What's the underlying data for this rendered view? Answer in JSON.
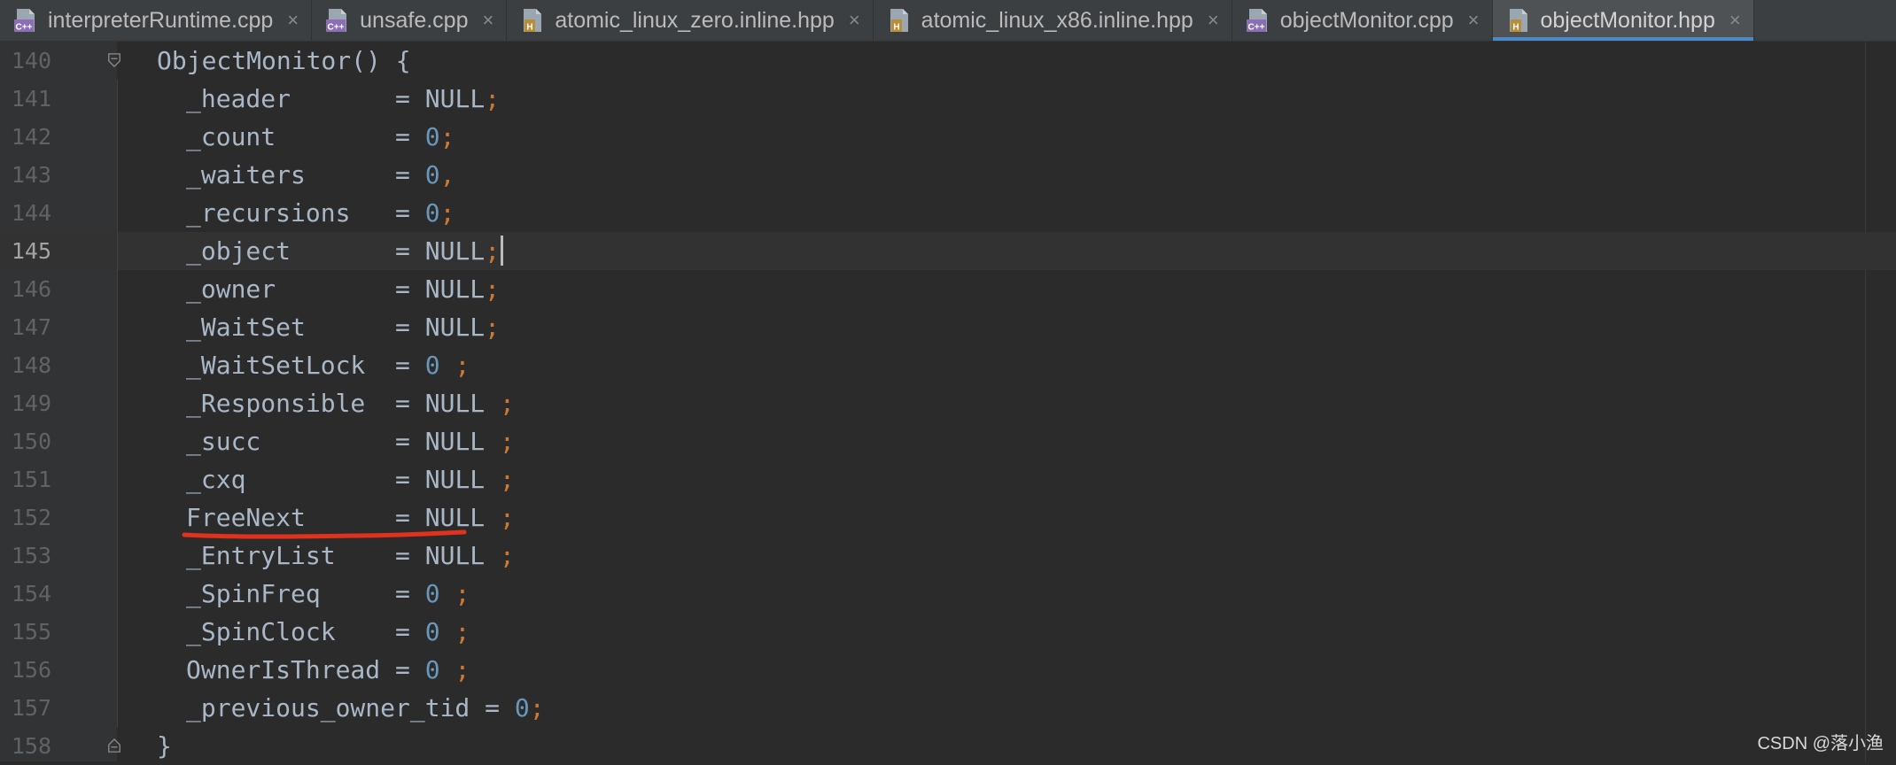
{
  "tabs": [
    {
      "label": "interpreterRuntime.cpp",
      "type": "cpp",
      "active": false
    },
    {
      "label": "unsafe.cpp",
      "type": "cpp",
      "active": false
    },
    {
      "label": "atomic_linux_zero.inline.hpp",
      "type": "hpp",
      "active": false
    },
    {
      "label": "atomic_linux_x86.inline.hpp",
      "type": "hpp",
      "active": false
    },
    {
      "label": "objectMonitor.cpp",
      "type": "cpp",
      "active": false
    },
    {
      "label": "objectMonitor.hpp",
      "type": "hpp",
      "active": true
    }
  ],
  "tab_close_glyph": "×",
  "icon_text": {
    "cpp": "C++",
    "hpp": "H"
  },
  "code": {
    "current_line": 145,
    "lines": [
      {
        "number": "140",
        "text": "ObjectMonitor() {"
      },
      {
        "number": "141",
        "name": "_header",
        "pad": "       ",
        "eq": "= ",
        "value": "NULL",
        "value_kind": "ident",
        "sep": "",
        "semi": ";"
      },
      {
        "number": "142",
        "name": "_count",
        "pad": "        ",
        "eq": "= ",
        "value": "0",
        "value_kind": "num",
        "sep": "",
        "semi": ";"
      },
      {
        "number": "143",
        "name": "_waiters",
        "pad": "      ",
        "eq": "= ",
        "value": "0",
        "value_kind": "num",
        "sep": "",
        "semi": ","
      },
      {
        "number": "144",
        "name": "_recursions",
        "pad": "   ",
        "eq": "= ",
        "value": "0",
        "value_kind": "num",
        "sep": "",
        "semi": ";"
      },
      {
        "number": "145",
        "name": "_object",
        "pad": "       ",
        "eq": "= ",
        "value": "NULL",
        "value_kind": "ident",
        "sep": "",
        "semi": ";"
      },
      {
        "number": "146",
        "name": "_owner",
        "pad": "        ",
        "eq": "= ",
        "value": "NULL",
        "value_kind": "ident",
        "sep": "",
        "semi": ";"
      },
      {
        "number": "147",
        "name": "_WaitSet",
        "pad": "      ",
        "eq": "= ",
        "value": "NULL",
        "value_kind": "ident",
        "sep": "",
        "semi": ";"
      },
      {
        "number": "148",
        "name": "_WaitSetLock",
        "pad": "  ",
        "eq": "= ",
        "value": "0",
        "value_kind": "num",
        "sep": " ",
        "semi": ";"
      },
      {
        "number": "149",
        "name": "_Responsible",
        "pad": "  ",
        "eq": "= ",
        "value": "NULL",
        "value_kind": "ident",
        "sep": " ",
        "semi": ";"
      },
      {
        "number": "150",
        "name": "_succ",
        "pad": "         ",
        "eq": "= ",
        "value": "NULL",
        "value_kind": "ident",
        "sep": " ",
        "semi": ";"
      },
      {
        "number": "151",
        "name": "_cxq",
        "pad": "          ",
        "eq": "= ",
        "value": "NULL",
        "value_kind": "ident",
        "sep": " ",
        "semi": ";"
      },
      {
        "number": "152",
        "name": "FreeNext",
        "pad": "      ",
        "eq": "= ",
        "value": "NULL",
        "value_kind": "ident",
        "sep": " ",
        "semi": ";"
      },
      {
        "number": "153",
        "name": "_EntryList",
        "pad": "    ",
        "eq": "= ",
        "value": "NULL",
        "value_kind": "ident",
        "sep": " ",
        "semi": ";"
      },
      {
        "number": "154",
        "name": "_SpinFreq",
        "pad": "     ",
        "eq": "= ",
        "value": "0",
        "value_kind": "num",
        "sep": " ",
        "semi": ";"
      },
      {
        "number": "155",
        "name": "_SpinClock",
        "pad": "    ",
        "eq": "= ",
        "value": "0",
        "value_kind": "num",
        "sep": " ",
        "semi": ";"
      },
      {
        "number": "156",
        "name": "OwnerIsThread",
        "pad": " ",
        "eq": "= ",
        "value": "0",
        "value_kind": "num",
        "sep": " ",
        "semi": ";"
      },
      {
        "number": "157",
        "name": "_previous_owner_tid",
        "pad": " ",
        "eq": "= ",
        "value": "0",
        "value_kind": "num",
        "sep": "",
        "semi": ";"
      },
      {
        "number": "158",
        "text": "}"
      }
    ]
  },
  "annotation": {
    "marked_line": "153",
    "color": "#e0321c"
  },
  "watermark": "CSDN @落小渔",
  "colors": {
    "background": "#2b2b2b",
    "gutter": "#313335",
    "text": "#a9b7c6",
    "number": "#6897bb",
    "punctuation": "#cc7832",
    "line_number": "#606366",
    "active_tab_underline": "#4a88c7",
    "cpp_icon": "#8b6fb5",
    "hpp_icon": "#b88d3a"
  }
}
